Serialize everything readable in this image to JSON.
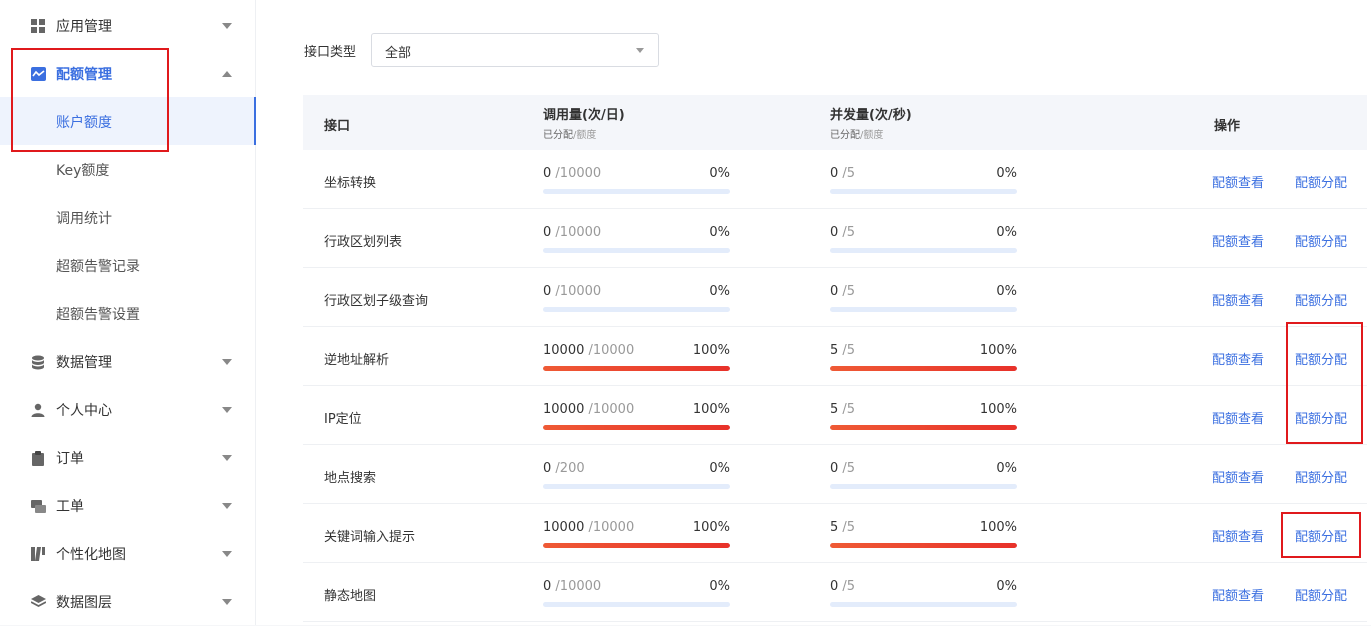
{
  "sidebar": {
    "items": [
      {
        "label": "应用管理",
        "icon": "grid-icon",
        "expanded": false
      },
      {
        "label": "配额管理",
        "icon": "chart-line-icon",
        "expanded": true,
        "children": [
          {
            "label": "账户额度",
            "active": true
          },
          {
            "label": "Key额度"
          },
          {
            "label": "调用统计"
          },
          {
            "label": "超额告警记录"
          },
          {
            "label": "超额告警设置"
          }
        ]
      },
      {
        "label": "数据管理",
        "icon": "database-icon",
        "expanded": false
      },
      {
        "label": "个人中心",
        "icon": "user-icon",
        "expanded": false
      },
      {
        "label": "订单",
        "icon": "clipboard-icon",
        "expanded": false
      },
      {
        "label": "工单",
        "icon": "ticket-icon",
        "expanded": false
      },
      {
        "label": "个性化地图",
        "icon": "map-style-icon",
        "expanded": false
      },
      {
        "label": "数据图层",
        "icon": "layers-icon",
        "expanded": false
      }
    ]
  },
  "filter": {
    "label": "接口类型",
    "selected": "全部"
  },
  "table": {
    "headers": {
      "api": "接口",
      "calls": "调用量(次/日)",
      "concurrency": "并发量(次/秒)",
      "sub_allocated": "已分配",
      "sub_quota": "/额度",
      "actions": "操作"
    },
    "action_view": "配额查看",
    "action_allocate": "配额分配",
    "rows": [
      {
        "name": "坐标转换",
        "calls_used": "0",
        "calls_quota": " /10000",
        "calls_pct": "0%",
        "calls_level": 0,
        "conc_used": "0",
        "conc_quota": " /5",
        "conc_pct": "0%",
        "conc_level": 0
      },
      {
        "name": "行政区划列表",
        "calls_used": "0",
        "calls_quota": " /10000",
        "calls_pct": "0%",
        "calls_level": 0,
        "conc_used": "0",
        "conc_quota": " /5",
        "conc_pct": "0%",
        "conc_level": 0
      },
      {
        "name": "行政区划子级查询",
        "calls_used": "0",
        "calls_quota": " /10000",
        "calls_pct": "0%",
        "calls_level": 0,
        "conc_used": "0",
        "conc_quota": " /5",
        "conc_pct": "0%",
        "conc_level": 0
      },
      {
        "name": "逆地址解析",
        "calls_used": "10000",
        "calls_quota": " /10000",
        "calls_pct": "100%",
        "calls_level": 100,
        "conc_used": "5",
        "conc_quota": " /5",
        "conc_pct": "100%",
        "conc_level": 100
      },
      {
        "name": "IP定位",
        "calls_used": "10000",
        "calls_quota": " /10000",
        "calls_pct": "100%",
        "calls_level": 100,
        "conc_used": "5",
        "conc_quota": " /5",
        "conc_pct": "100%",
        "conc_level": 100
      },
      {
        "name": "地点搜索",
        "calls_used": "0",
        "calls_quota": " /200",
        "calls_pct": "0%",
        "calls_level": 0,
        "conc_used": "0",
        "conc_quota": " /5",
        "conc_pct": "0%",
        "conc_level": 0
      },
      {
        "name": "关键词输入提示",
        "calls_used": "10000",
        "calls_quota": " /10000",
        "calls_pct": "100%",
        "calls_level": 100,
        "conc_used": "5",
        "conc_quota": " /5",
        "conc_pct": "100%",
        "conc_level": 100
      },
      {
        "name": "静态地图",
        "calls_used": "0",
        "calls_quota": " /10000",
        "calls_pct": "0%",
        "calls_level": 0,
        "conc_used": "0",
        "conc_quota": " /5",
        "conc_pct": "0%",
        "conc_level": 0
      }
    ]
  },
  "colors": {
    "accent": "#3b6fe0",
    "highlight": "#e0191c",
    "bar_full": "#e8312a",
    "bar_track": "#e3ecfb"
  }
}
